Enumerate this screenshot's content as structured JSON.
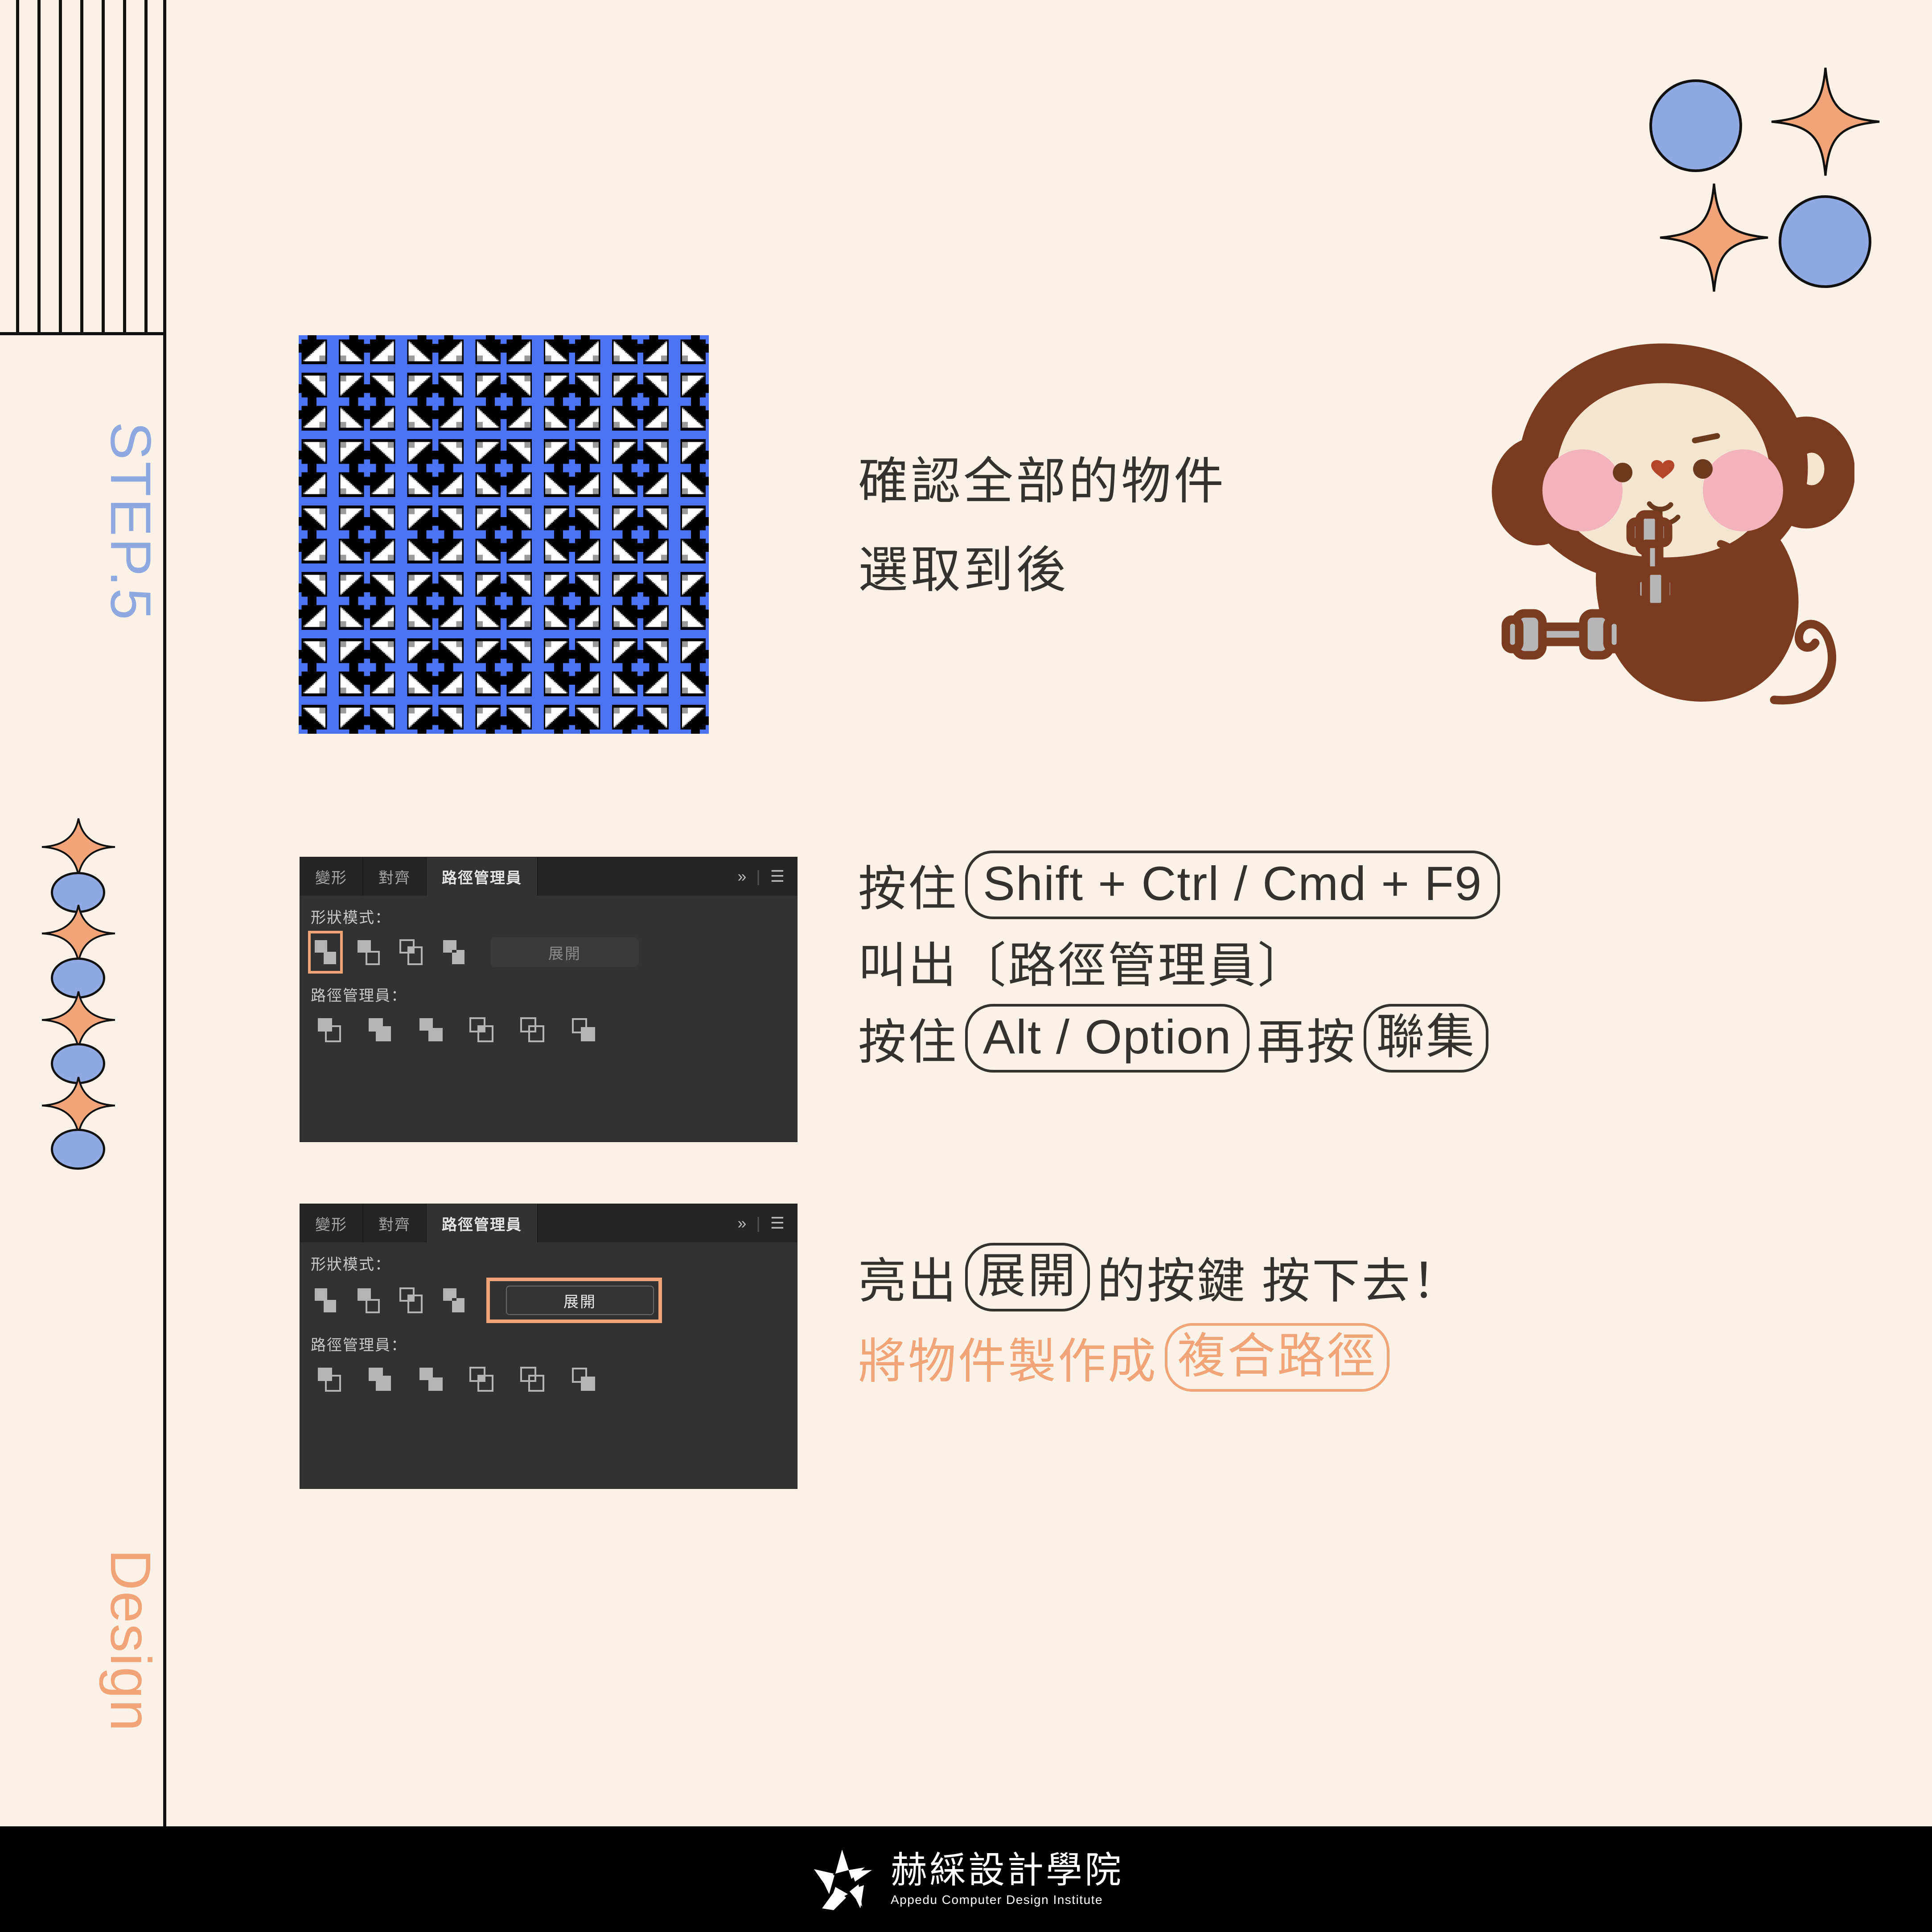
{
  "theme": {
    "background": "#FAF2E6",
    "ink": "#33322F",
    "accent_orange": "#F0A477",
    "accent_blue": "#90A9E3",
    "pattern_blue": "#4D73F5",
    "panel_bg": "#323232",
    "panel_tabbar": "#252525"
  },
  "sidebar": {
    "step_label": "STEP.5",
    "brand_label": "Design"
  },
  "artwork": {
    "name": "blue-black-tiled-pattern"
  },
  "headline": {
    "line1": "確認全部的物件",
    "line2": "選取到後"
  },
  "panel_one": {
    "tabs": [
      {
        "label": "變形",
        "active": false
      },
      {
        "label": "對齊",
        "active": false
      },
      {
        "label": "路徑管理員",
        "active": true
      }
    ],
    "tab_icons": {
      "expand": "»",
      "menu": "☰"
    },
    "shape_modes_label": "形狀模式：",
    "pathfinders_label": "路徑管理員：",
    "expand_button": "展開",
    "expand_enabled": false,
    "selected_shape_mode_index": 0,
    "shape_mode_buttons": [
      "unite",
      "minus-front",
      "intersect",
      "exclude"
    ],
    "pathfinder_buttons": [
      "divide",
      "trim",
      "merge",
      "crop",
      "outline",
      "minus-back"
    ]
  },
  "panel_two": {
    "tabs": [
      {
        "label": "變形",
        "active": false
      },
      {
        "label": "對齊",
        "active": false
      },
      {
        "label": "路徑管理員",
        "active": true
      }
    ],
    "tab_icons": {
      "expand": "»",
      "menu": "☰"
    },
    "shape_modes_label": "形狀模式：",
    "pathfinders_label": "路徑管理員：",
    "expand_button": "展開",
    "expand_enabled": true,
    "expand_highlighted": true,
    "selected_shape_mode_index": -1,
    "shape_mode_buttons": [
      "unite",
      "minus-front",
      "intersect",
      "exclude"
    ],
    "pathfinder_buttons": [
      "divide",
      "trim",
      "merge",
      "crop",
      "outline",
      "minus-back"
    ]
  },
  "instructions_upper": {
    "row1_prefix": "按住",
    "row1_key": "Shift + Ctrl / Cmd + F9",
    "row2": "叫出〔路徑管理員〕",
    "row3_prefix": "按住",
    "row3_key": "Alt / Option",
    "row3_middle": "再按",
    "row3_key2": "聯集"
  },
  "instructions_lower": {
    "row1_prefix": "亮出",
    "row1_key": "展開",
    "row1_suffix": "的按鍵 按下去！",
    "row2_prefix": "將物件製作成",
    "row2_key": "複合路徑"
  },
  "footer": {
    "name_cn": "赫綵設計學院",
    "name_en": "Appedu Computer Design Institute",
    "mark": "star-logo-icon"
  }
}
